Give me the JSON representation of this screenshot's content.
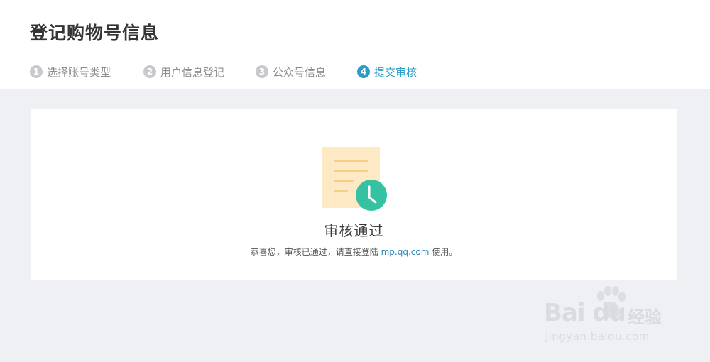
{
  "header": {
    "title": "登记购物号信息"
  },
  "steps": [
    {
      "number": "1",
      "label": "选择账号类型",
      "state": "done"
    },
    {
      "number": "2",
      "label": "用户信息登记",
      "state": "done"
    },
    {
      "number": "3",
      "label": "公众号信息",
      "state": "done"
    },
    {
      "number": "4",
      "label": "提交审核",
      "state": "active"
    }
  ],
  "result": {
    "title": "审核通过",
    "desc_before": "恭喜您，审核已通过，请直接登陆 ",
    "link_text": "mp.qq.com",
    "desc_after": " 使用。",
    "icon": "document-clock-icon"
  },
  "watermark": {
    "logo": "Bai du",
    "suffix": "经验",
    "url": "jingyan.baidu.com"
  },
  "colors": {
    "accent": "#2b9cc6",
    "clock": "#34c2a2",
    "doc": "#fde9c4",
    "background": "#eef0f4"
  }
}
